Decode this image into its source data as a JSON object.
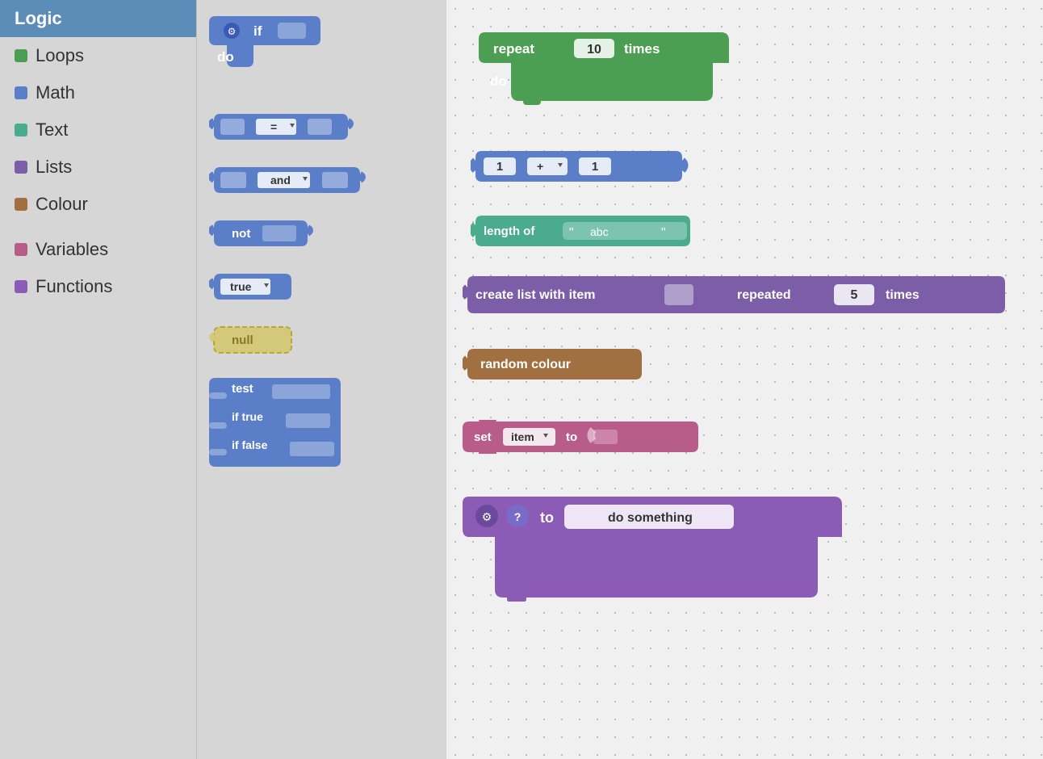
{
  "sidebar": {
    "items": [
      {
        "id": "logic",
        "label": "Logic",
        "color": "#5b8db8",
        "active": true,
        "dot": null
      },
      {
        "id": "loops",
        "label": "Loops",
        "color": "#4c9e52",
        "dot": "#4c9e52"
      },
      {
        "id": "math",
        "label": "Math",
        "color": "#5b7ec9",
        "dot": "#5b7ec9"
      },
      {
        "id": "text",
        "label": "Text",
        "color": "#4aab8e",
        "dot": "#4aab8e"
      },
      {
        "id": "lists",
        "label": "Lists",
        "color": "#7b5ea7",
        "dot": "#7b5ea7"
      },
      {
        "id": "colour",
        "label": "Colour",
        "color": "#a07040",
        "dot": "#a07040"
      },
      {
        "id": "variables",
        "label": "Variables",
        "color": "#b85c8a",
        "dot": "#b85c8a"
      },
      {
        "id": "functions",
        "label": "Functions",
        "color": "#8b5bb5",
        "dot": "#8b5bb5"
      }
    ]
  },
  "panel_blocks": [
    {
      "id": "if-block",
      "label": "if",
      "type": "c-blue"
    },
    {
      "id": "equals-block",
      "label": "=",
      "type": "op-blue"
    },
    {
      "id": "and-block",
      "label": "and",
      "type": "op-blue"
    },
    {
      "id": "not-block",
      "label": "not",
      "type": "op-blue"
    },
    {
      "id": "true-block",
      "label": "true",
      "type": "val-blue"
    },
    {
      "id": "null-block",
      "label": "null",
      "type": "val-yellow"
    },
    {
      "id": "ternary-block",
      "label": "test\nif true\nif false",
      "type": "c-blue-tall"
    }
  ],
  "canvas_blocks": {
    "repeat_block": {
      "label_before": "repeat",
      "value": "10",
      "label_after": "times",
      "inner_label": "do"
    },
    "math_block": {
      "val1": "1",
      "op": "+",
      "val2": "1"
    },
    "text_block": {
      "label": "length of",
      "text_value": "abc"
    },
    "list_block": {
      "label_before": "create list with item",
      "label_middle": "repeated",
      "value": "5",
      "label_after": "times"
    },
    "colour_block": {
      "label": "random colour"
    },
    "variable_block": {
      "label_before": "set",
      "var_name": "item",
      "label_after": "to"
    },
    "function_block": {
      "label_before": "to",
      "func_name": "do something"
    }
  },
  "colors": {
    "blue": "#5b7ec9",
    "blue_dark": "#3a5ab8",
    "green": "#4c9e52",
    "teal": "#4aab8e",
    "teal_light": "#7dc4b0",
    "purple": "#7b5ea7",
    "purple_dark": "#6a4a9a",
    "purple_func": "#8b5bb5",
    "brown": "#a07040",
    "pink": "#b85c8a",
    "yellow": "#d4c87a",
    "sidebar_active": "#5b8db8",
    "sidebar_bg": "#d6d6d6"
  }
}
